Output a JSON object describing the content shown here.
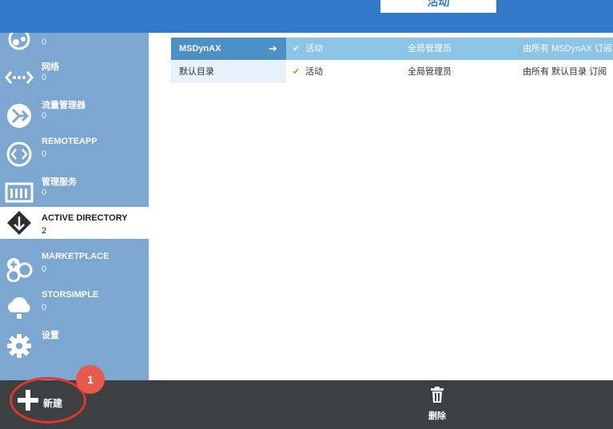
{
  "header": {
    "status_tab": "活动"
  },
  "sidebar": {
    "items": [
      {
        "label": "",
        "count": "0",
        "icon": "globe-partial-icon"
      },
      {
        "label": "网络",
        "count": "0",
        "icon": "network-icon"
      },
      {
        "label": "流量管理器",
        "count": "0",
        "icon": "traffic-manager-icon"
      },
      {
        "label": "REMOTEAPP",
        "count": "0",
        "icon": "remoteapp-icon"
      },
      {
        "label": "管理服务",
        "count": "0",
        "icon": "management-services-icon"
      },
      {
        "label": "ACTIVE DIRECTORY",
        "count": "2",
        "icon": "active-directory-icon",
        "active": true
      },
      {
        "label": "MARKETPLACE",
        "count": "0",
        "icon": "marketplace-icon"
      },
      {
        "label": "STORSIMPLE",
        "count": "0",
        "icon": "storsimple-cloud-icon"
      },
      {
        "label": "设置",
        "count": "",
        "icon": "gear-icon"
      }
    ]
  },
  "directory": {
    "rows": [
      {
        "name": "MSDynAX",
        "status": "活动",
        "role": "全局管理员",
        "subscription": "由所有 MSDynAX 订阅",
        "selected": true
      },
      {
        "name": "默认目录",
        "status": "活动",
        "role": "全局管理员",
        "subscription": "由所有 默认目录 订阅",
        "selected": false
      }
    ]
  },
  "commandbar": {
    "new_label": "新建",
    "delete_label": "删除",
    "callout_number": "1"
  },
  "colors": {
    "header_blue": "#2f79c8",
    "sidebar_blue": "#7ba7d0",
    "selected_row": "#8cc4e6",
    "command_bar": "#3c4043",
    "annotation_red": "#e2362b"
  }
}
